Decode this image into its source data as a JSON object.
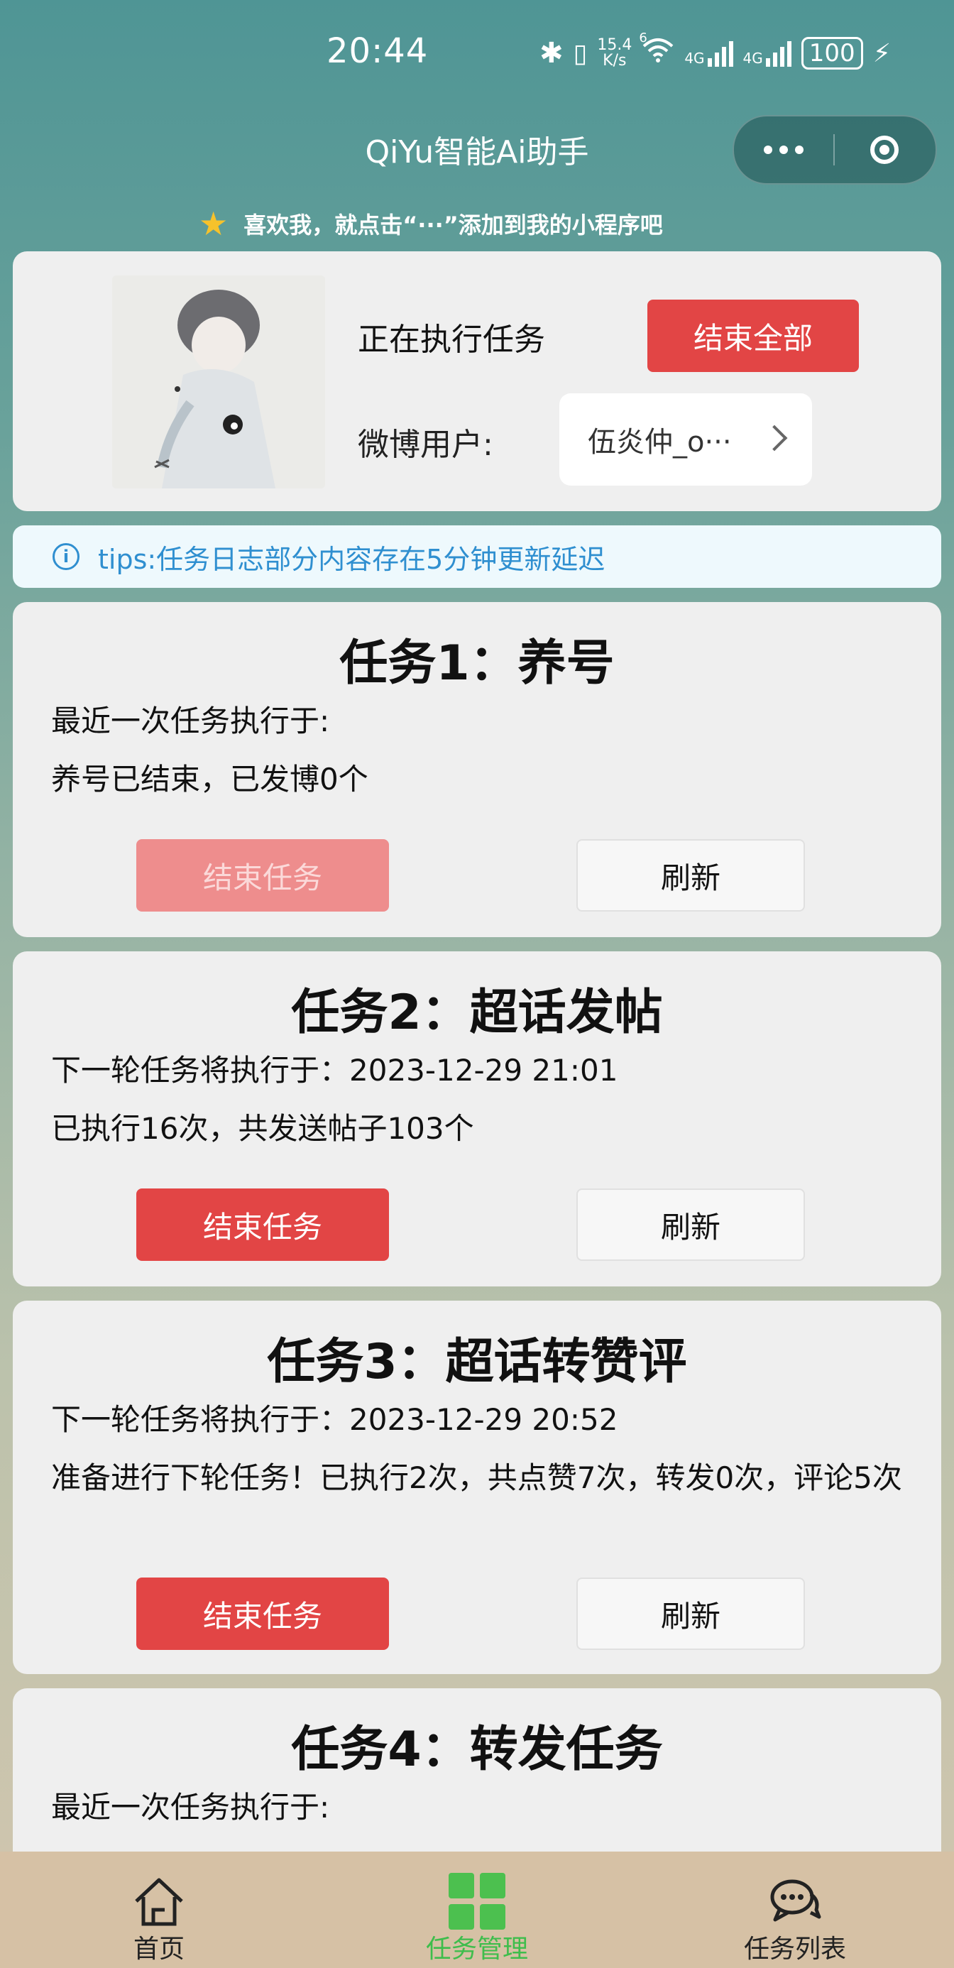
{
  "status_bar": {
    "time": "20:44",
    "net_speed_value": "15.4",
    "net_speed_unit": "K/s",
    "wifi_badge": "6",
    "sim1": "4G",
    "sim2": "4G",
    "battery": "100"
  },
  "header": {
    "title": "QiYu智能Ai助手",
    "hint": "喜欢我，就点击“···”添加到我的小程序吧"
  },
  "user_panel": {
    "running_label": "正在执行任务",
    "end_all_label": "结束全部",
    "weibo_label": "微博用户:",
    "weibo_user": "伍炎仲_o···"
  },
  "tips": "tips:任务日志部分内容存在5分钟更新延迟",
  "tasks": [
    {
      "title": "任务1：养号",
      "line1": "最近一次任务执行于:",
      "line2": "养号已结束，已发博0个",
      "end_label": "结束任务",
      "end_disabled": true,
      "refresh_label": "刷新"
    },
    {
      "title": "任务2：超话发帖",
      "line1": "下一轮任务将执行于：2023-12-29 21:01",
      "line2": "已执行16次，共发送帖子103个",
      "end_label": "结束任务",
      "end_disabled": false,
      "refresh_label": "刷新"
    },
    {
      "title": "任务3：超话转赞评",
      "line1": "下一轮任务将执行于：2023-12-29 20:52",
      "line2": "准备进行下轮任务！已执行2次，共点赞7次，转发0次，评论5次",
      "end_label": "结束任务",
      "end_disabled": false,
      "refresh_label": "刷新"
    },
    {
      "title": "任务4：转发任务",
      "line1": "最近一次任务执行于:"
    }
  ],
  "tabbar": {
    "items": [
      {
        "label": "首页",
        "icon": "home-icon",
        "active": false
      },
      {
        "label": "任务管理",
        "icon": "grid-icon",
        "active": true
      },
      {
        "label": "任务列表",
        "icon": "chat-icon",
        "active": false
      }
    ],
    "active_color": "#3ebd4c"
  },
  "colors": {
    "danger": "#e24545",
    "tips_text": "#2f8fd0"
  }
}
